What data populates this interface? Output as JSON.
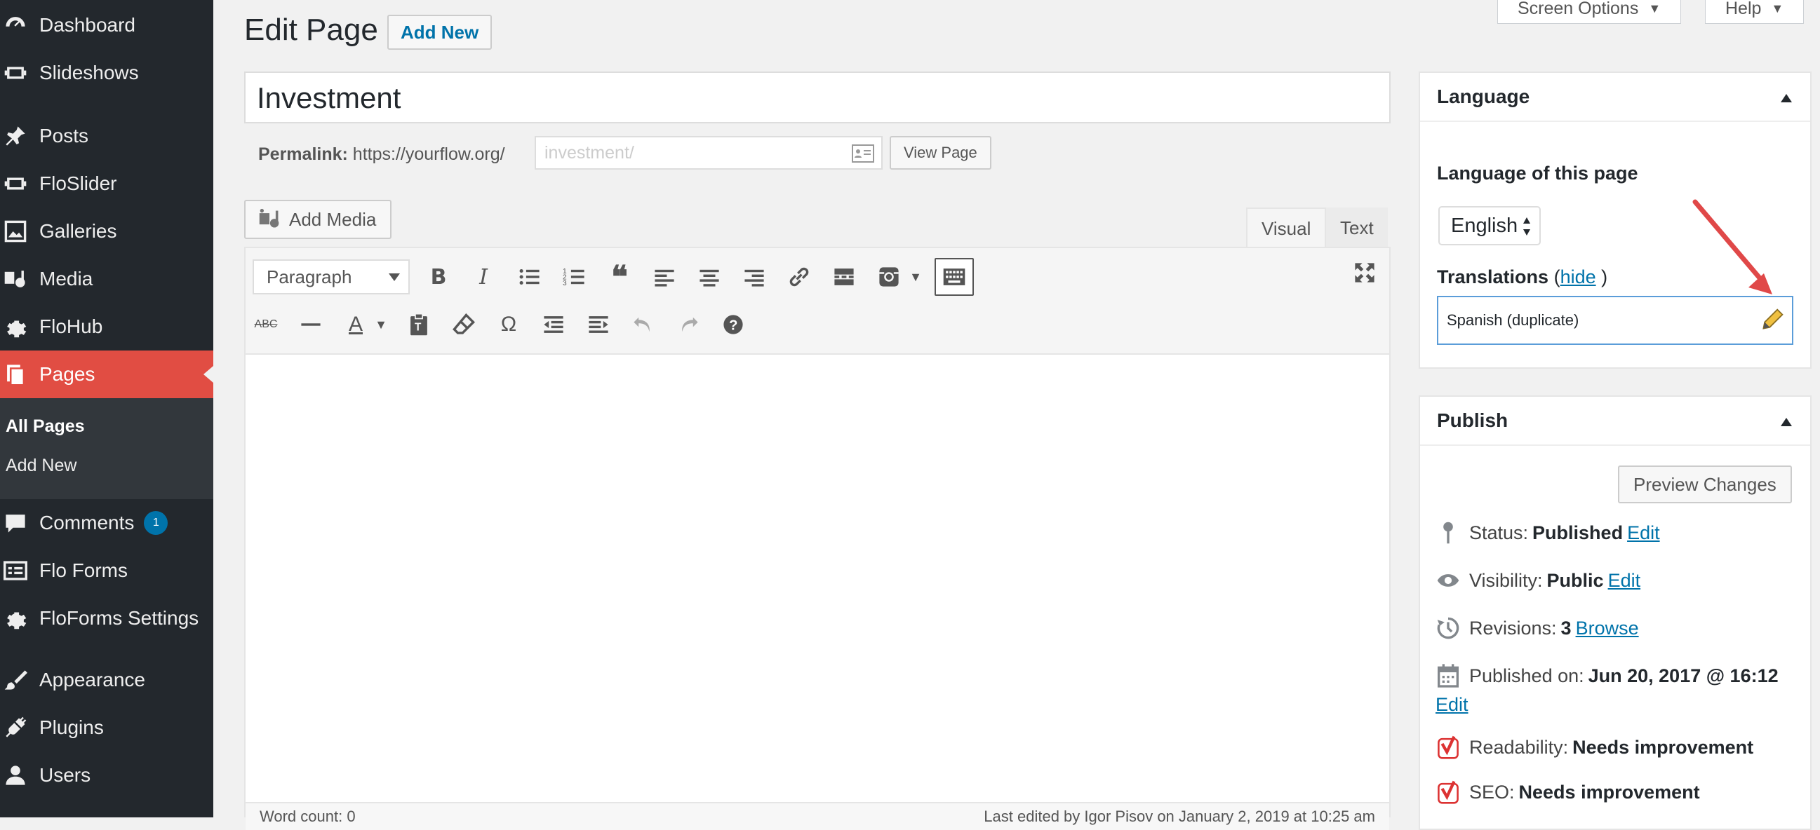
{
  "sidebar": {
    "items": [
      {
        "label": "Dashboard",
        "icon": "dashboard-icon"
      },
      {
        "label": "Slideshows",
        "icon": "slides-icon"
      },
      {
        "label": "Posts",
        "icon": "pin-icon"
      },
      {
        "label": "FloSlider",
        "icon": "slides-icon"
      },
      {
        "label": "Galleries",
        "icon": "gallery-icon"
      },
      {
        "label": "Media",
        "icon": "media-icon"
      },
      {
        "label": "FloHub",
        "icon": "gear-icon"
      },
      {
        "label": "Pages",
        "icon": "pages-icon"
      },
      {
        "label": "Comments",
        "icon": "comment-icon",
        "badge": "1"
      },
      {
        "label": "Flo Forms",
        "icon": "forms-icon"
      },
      {
        "label": "FloForms Settings",
        "icon": "gear-icon"
      },
      {
        "label": "Appearance",
        "icon": "brush-icon"
      },
      {
        "label": "Plugins",
        "icon": "plugin-icon"
      },
      {
        "label": "Users",
        "icon": "user-icon"
      }
    ],
    "submenu": [
      "All Pages",
      "Add New"
    ]
  },
  "top_buttons": {
    "screen_options": "Screen Options",
    "help": "Help"
  },
  "header": {
    "title": "Edit Page",
    "add_new": "Add New"
  },
  "post": {
    "title": "Investment",
    "permalink_label": "Permalink:",
    "permalink_base": "https://yourflow.org/",
    "slug": "investment/",
    "view_page": "View Page"
  },
  "editor": {
    "add_media": "Add Media",
    "tab_visual": "Visual",
    "tab_text": "Text",
    "format": "Paragraph",
    "word_count": "Word count: 0",
    "last_edited": "Last edited by Igor Pisov on January 2, 2019 at 10:25 am"
  },
  "language_panel": {
    "title": "Language",
    "language_label": "Language of this page",
    "language_value": "English",
    "translations_label": "Translations",
    "hide_link": "hide",
    "translation_value": "Spanish (duplicate)"
  },
  "publish_panel": {
    "title": "Publish",
    "preview": "Preview Changes",
    "status_label": "Status:",
    "status_value": "Published",
    "visibility_label": "Visibility:",
    "visibility_value": "Public",
    "revisions_label": "Revisions:",
    "revisions_value": "3",
    "browse": "Browse",
    "published_label": "Published on:",
    "published_value": "Jun 20, 2017 @ 16:12",
    "edit": "Edit",
    "readability_label": "Readability:",
    "readability_value": "Needs improvement",
    "seo_label": "SEO:",
    "seo_value": "Needs improvement"
  },
  "colors": {
    "sidebar": "#23282d",
    "active": "#e14d43",
    "link": "#0073aa",
    "annotation_arrow": "#e04848"
  }
}
